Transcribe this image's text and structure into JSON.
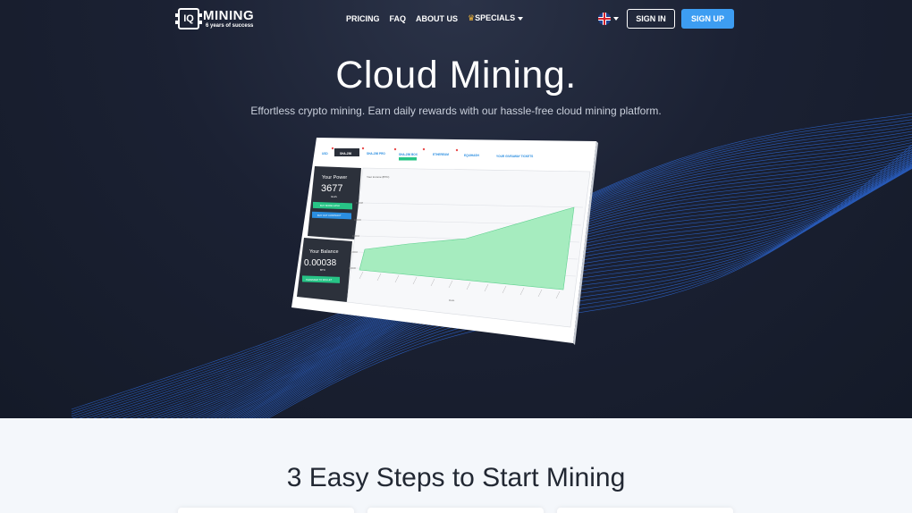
{
  "nav": {
    "logo": {
      "word": "MINING",
      "chip_label": "IQ",
      "tagline": "6 years of success"
    },
    "links": [
      {
        "label": "PRICING"
      },
      {
        "label": "FAQ"
      },
      {
        "label": "ABOUT US"
      },
      {
        "label": "SPECIALS",
        "icon": "crown-icon",
        "dropdown": true
      }
    ],
    "language": {
      "flag": "uk-flag-icon",
      "dropdown": true
    },
    "sign_in": "SIGN IN",
    "sign_up": "SIGN UP"
  },
  "hero": {
    "title": "Cloud Mining.",
    "subtitle": "Effortless crypto mining. Earn daily rewards with our hassle-free cloud mining platform."
  },
  "mockup": {
    "tabs": [
      "USD",
      "SHA-256",
      "SHA-256 PRO",
      "SHA-256 BOX",
      "ETHEREUM",
      "EQUIHASH",
      "YOUR GIVEAWAY TICKETS"
    ],
    "power_label": "Your Power",
    "power_value": "3677",
    "power_unit": "GH/s",
    "btn_buy_more": "BUY MORE HASH",
    "btn_buy_contract": "BUY OUT CONTRACT",
    "balance_label": "Your Balance",
    "balance_value": "0.00038",
    "balance_unit": "BTC",
    "btn_transfer": "TRANSFER TO WALLET",
    "chart_title": "Your income (BTC)",
    "x_label": "Date",
    "y_ticks": [
      "0.0008",
      "0.0006",
      "0.0004",
      "0.0002",
      "0.0000"
    ]
  },
  "steps": {
    "title": "3 Easy Steps to Start Mining"
  },
  "colors": {
    "accent": "#3d9df2",
    "hero_bg": "#1b2133",
    "chart_fill": "#a6ecbf",
    "panel_green": "#27c486",
    "panel_blue": "#2b8ee0"
  }
}
